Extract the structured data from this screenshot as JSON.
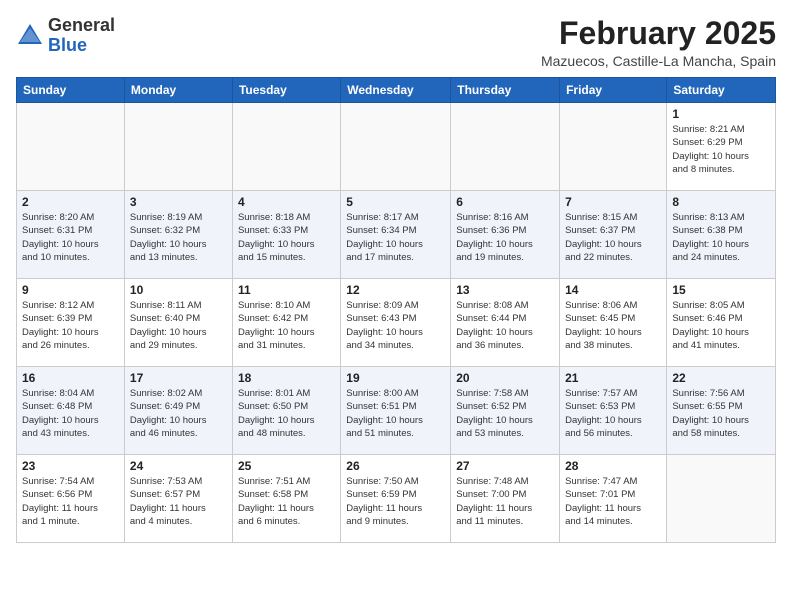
{
  "header": {
    "logo_general": "General",
    "logo_blue": "Blue",
    "month_title": "February 2025",
    "location": "Mazuecos, Castille-La Mancha, Spain"
  },
  "weekdays": [
    "Sunday",
    "Monday",
    "Tuesday",
    "Wednesday",
    "Thursday",
    "Friday",
    "Saturday"
  ],
  "weeks": [
    [
      {
        "day": "",
        "info": ""
      },
      {
        "day": "",
        "info": ""
      },
      {
        "day": "",
        "info": ""
      },
      {
        "day": "",
        "info": ""
      },
      {
        "day": "",
        "info": ""
      },
      {
        "day": "",
        "info": ""
      },
      {
        "day": "1",
        "info": "Sunrise: 8:21 AM\nSunset: 6:29 PM\nDaylight: 10 hours\nand 8 minutes."
      }
    ],
    [
      {
        "day": "2",
        "info": "Sunrise: 8:20 AM\nSunset: 6:31 PM\nDaylight: 10 hours\nand 10 minutes."
      },
      {
        "day": "3",
        "info": "Sunrise: 8:19 AM\nSunset: 6:32 PM\nDaylight: 10 hours\nand 13 minutes."
      },
      {
        "day": "4",
        "info": "Sunrise: 8:18 AM\nSunset: 6:33 PM\nDaylight: 10 hours\nand 15 minutes."
      },
      {
        "day": "5",
        "info": "Sunrise: 8:17 AM\nSunset: 6:34 PM\nDaylight: 10 hours\nand 17 minutes."
      },
      {
        "day": "6",
        "info": "Sunrise: 8:16 AM\nSunset: 6:36 PM\nDaylight: 10 hours\nand 19 minutes."
      },
      {
        "day": "7",
        "info": "Sunrise: 8:15 AM\nSunset: 6:37 PM\nDaylight: 10 hours\nand 22 minutes."
      },
      {
        "day": "8",
        "info": "Sunrise: 8:13 AM\nSunset: 6:38 PM\nDaylight: 10 hours\nand 24 minutes."
      }
    ],
    [
      {
        "day": "9",
        "info": "Sunrise: 8:12 AM\nSunset: 6:39 PM\nDaylight: 10 hours\nand 26 minutes."
      },
      {
        "day": "10",
        "info": "Sunrise: 8:11 AM\nSunset: 6:40 PM\nDaylight: 10 hours\nand 29 minutes."
      },
      {
        "day": "11",
        "info": "Sunrise: 8:10 AM\nSunset: 6:42 PM\nDaylight: 10 hours\nand 31 minutes."
      },
      {
        "day": "12",
        "info": "Sunrise: 8:09 AM\nSunset: 6:43 PM\nDaylight: 10 hours\nand 34 minutes."
      },
      {
        "day": "13",
        "info": "Sunrise: 8:08 AM\nSunset: 6:44 PM\nDaylight: 10 hours\nand 36 minutes."
      },
      {
        "day": "14",
        "info": "Sunrise: 8:06 AM\nSunset: 6:45 PM\nDaylight: 10 hours\nand 38 minutes."
      },
      {
        "day": "15",
        "info": "Sunrise: 8:05 AM\nSunset: 6:46 PM\nDaylight: 10 hours\nand 41 minutes."
      }
    ],
    [
      {
        "day": "16",
        "info": "Sunrise: 8:04 AM\nSunset: 6:48 PM\nDaylight: 10 hours\nand 43 minutes."
      },
      {
        "day": "17",
        "info": "Sunrise: 8:02 AM\nSunset: 6:49 PM\nDaylight: 10 hours\nand 46 minutes."
      },
      {
        "day": "18",
        "info": "Sunrise: 8:01 AM\nSunset: 6:50 PM\nDaylight: 10 hours\nand 48 minutes."
      },
      {
        "day": "19",
        "info": "Sunrise: 8:00 AM\nSunset: 6:51 PM\nDaylight: 10 hours\nand 51 minutes."
      },
      {
        "day": "20",
        "info": "Sunrise: 7:58 AM\nSunset: 6:52 PM\nDaylight: 10 hours\nand 53 minutes."
      },
      {
        "day": "21",
        "info": "Sunrise: 7:57 AM\nSunset: 6:53 PM\nDaylight: 10 hours\nand 56 minutes."
      },
      {
        "day": "22",
        "info": "Sunrise: 7:56 AM\nSunset: 6:55 PM\nDaylight: 10 hours\nand 58 minutes."
      }
    ],
    [
      {
        "day": "23",
        "info": "Sunrise: 7:54 AM\nSunset: 6:56 PM\nDaylight: 11 hours\nand 1 minute."
      },
      {
        "day": "24",
        "info": "Sunrise: 7:53 AM\nSunset: 6:57 PM\nDaylight: 11 hours\nand 4 minutes."
      },
      {
        "day": "25",
        "info": "Sunrise: 7:51 AM\nSunset: 6:58 PM\nDaylight: 11 hours\nand 6 minutes."
      },
      {
        "day": "26",
        "info": "Sunrise: 7:50 AM\nSunset: 6:59 PM\nDaylight: 11 hours\nand 9 minutes."
      },
      {
        "day": "27",
        "info": "Sunrise: 7:48 AM\nSunset: 7:00 PM\nDaylight: 11 hours\nand 11 minutes."
      },
      {
        "day": "28",
        "info": "Sunrise: 7:47 AM\nSunset: 7:01 PM\nDaylight: 11 hours\nand 14 minutes."
      },
      {
        "day": "",
        "info": ""
      }
    ]
  ]
}
